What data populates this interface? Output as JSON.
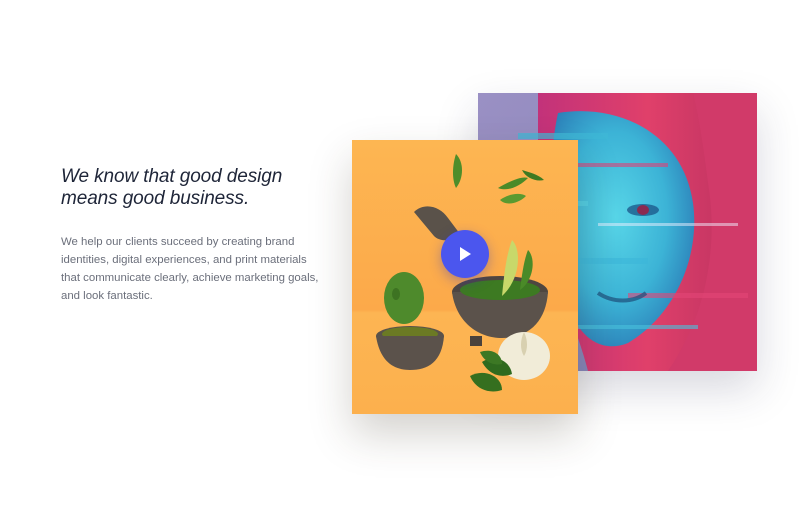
{
  "intro": {
    "headline_line1": "We know that good design",
    "headline_line2": "means good business.",
    "body_lines": [
      "We help our clients succeed by creating brand",
      "identities, digital experiences, and print materials",
      "that communicate clearly, achieve marketing goals,",
      "and look fantastic."
    ]
  },
  "media": {
    "video_thumbnail": {
      "icon": "play-icon",
      "accent_color": "#4b56ee",
      "background_color": "#fdb24f"
    },
    "portrait_image": {
      "palette": [
        "#8f8ab8",
        "#d9386d",
        "#3cc2dc"
      ]
    }
  }
}
